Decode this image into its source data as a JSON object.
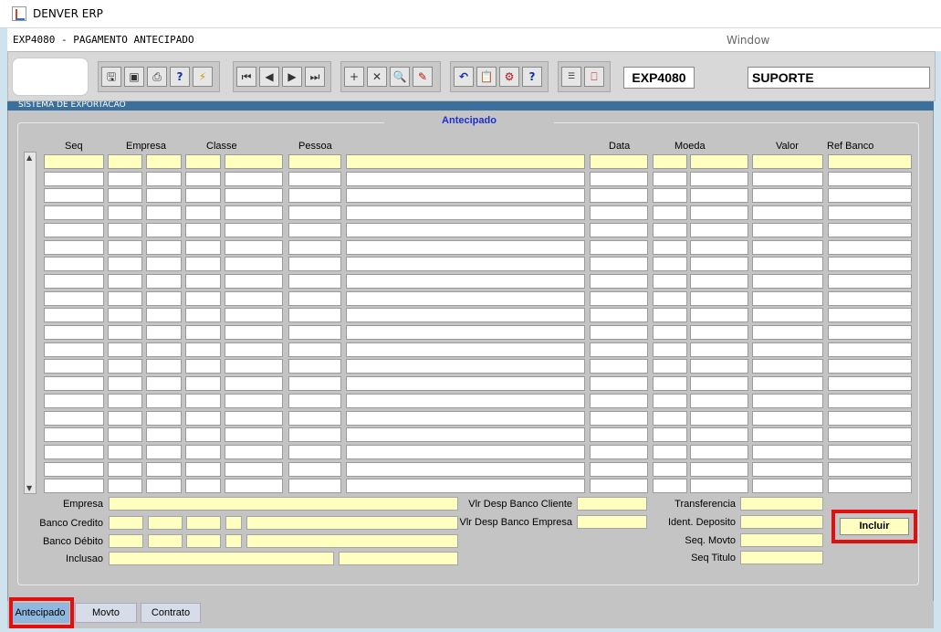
{
  "window": {
    "title": "DENVER ERP"
  },
  "menubar": {
    "form_title": "EXP4080 - PAGAMENTO ANTECIPADO",
    "window_menu": "Window"
  },
  "toolbar": {
    "program_code": "EXP4080",
    "user": "SUPORTE",
    "icons": [
      "save-icon",
      "print-preview-icon",
      "print-icon",
      "help-query-icon",
      "execute-query-icon",
      "first-record-icon",
      "previous-record-icon",
      "next-record-icon",
      "last-record-icon",
      "insert-record-icon",
      "delete-record-icon",
      "search-icon",
      "edit-icon",
      "undo-icon",
      "clipboard-icon",
      "user-settings-icon",
      "help-icon",
      "menu-icon",
      "exit-icon"
    ]
  },
  "strip_text": "SISTEMA DE EXPORTACAO",
  "section_title": "Antecipado",
  "grid": {
    "headers": [
      "Seq",
      "Empresa",
      "Classe",
      "Pessoa",
      "Data",
      "Moeda",
      "Valor",
      "Ref Banco"
    ],
    "row_count": 20
  },
  "form": {
    "empresa_label": "Empresa",
    "banco_credito_label": "Banco Credito",
    "banco_debito_label": "Banco Débito",
    "inclusao_label": "Inclusao",
    "vlr_desp_cliente_label": "Vlr Desp Banco Cliente",
    "vlr_desp_empresa_label": "Vlr Desp Banco Empresa",
    "transferencia_label": "Transferencia",
    "ident_deposito_label": "Ident. Deposito",
    "seq_movto_label": "Seq. Movto",
    "seq_titulo_label": "Seq Titulo",
    "incluir_label": "Incluir"
  },
  "tabs": [
    {
      "label": "Antecipado",
      "selected": true
    },
    {
      "label": "Movto",
      "selected": false
    },
    {
      "label": "Contrato",
      "selected": false
    }
  ],
  "colors": {
    "highlight": "#e01010",
    "legend": "#1a2fd0",
    "field_yellow": "#ffffc0",
    "tab_selected": "#8fb8e0"
  }
}
